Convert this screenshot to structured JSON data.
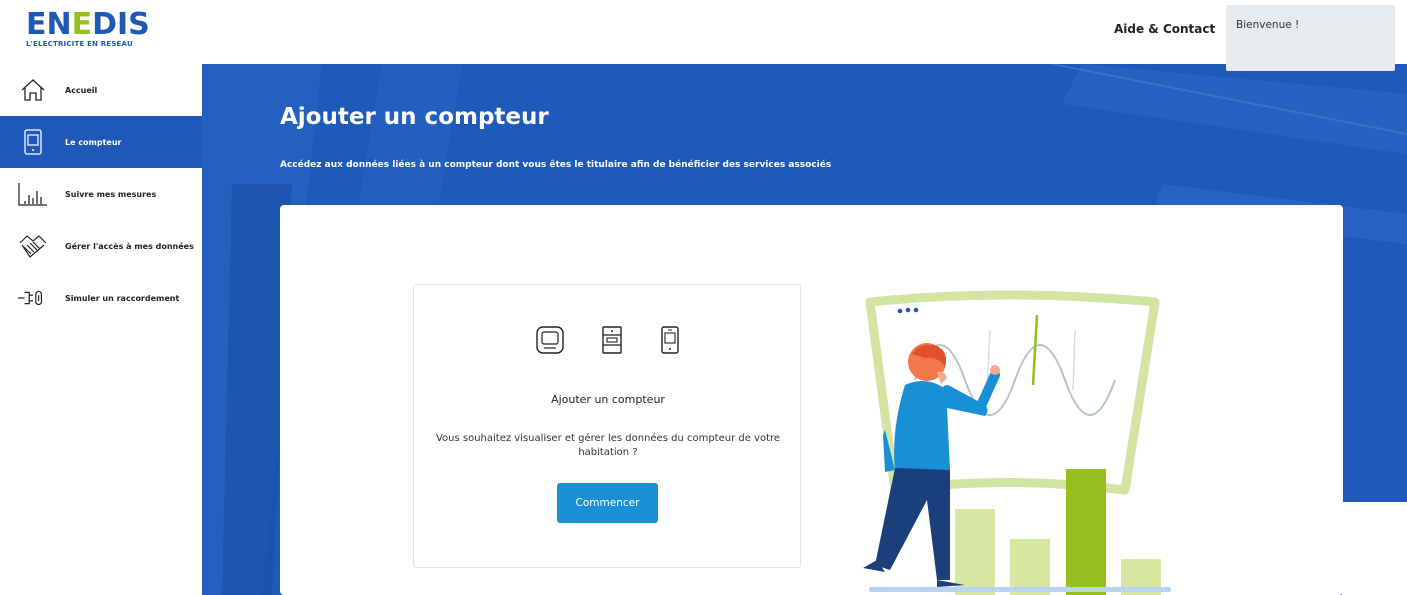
{
  "header": {
    "logo_word_a": "EN",
    "logo_word_b": "E",
    "logo_word_c": "DIS",
    "logo_tagline": "L'ELECTRICITE EN RESEAU",
    "help_link": "Aide & Contact",
    "welcome_text": "Bienvenue !"
  },
  "sidebar": {
    "items": [
      {
        "label": "Accueil",
        "icon": "home-icon",
        "active": false
      },
      {
        "label": "Le compteur",
        "icon": "meter-icon",
        "active": true
      },
      {
        "label": "Suivre mes mesures",
        "icon": "bar-chart-icon",
        "active": false
      },
      {
        "label": "Gérer l'accès à mes données",
        "icon": "handshake-icon",
        "active": false
      },
      {
        "label": "Simuler un raccordement",
        "icon": "plug-icon",
        "active": false
      }
    ]
  },
  "hero": {
    "title": "Ajouter un compteur",
    "subtitle": "Accédez aux données liées à un compteur dont vous êtes le titulaire afin de bénéficier des services associés"
  },
  "card": {
    "title": "Ajouter un compteur",
    "description": "Vous souhaitez visualiser et gérer les données du compteur de votre habitation ?",
    "button_label": "Commencer",
    "meter_icons": [
      "electronic-meter-icon",
      "electromechanical-meter-icon",
      "linky-meter-icon"
    ]
  },
  "colors": {
    "brand_blue": "#1f58b8",
    "brand_green": "#93c01f",
    "button_blue": "#1990d6",
    "welcome_bg": "#e7ebef"
  }
}
